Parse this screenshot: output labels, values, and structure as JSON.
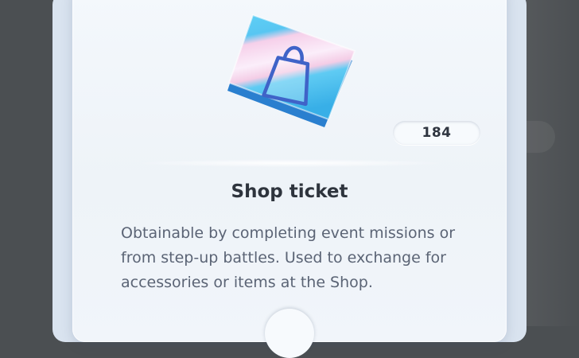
{
  "item": {
    "name": "Shop ticket",
    "count": "184",
    "description": "Obtainable by completing event missions or from step-up battles. Used to exchange for accessories or items at the Shop.",
    "icon": "shopping-bag-icon"
  },
  "colors": {
    "ticket_blue": "#3ab3ea",
    "ticket_pink": "#f3cbe6",
    "bag_outline": "#3f63c8",
    "title_text": "#2e343d",
    "body_text": "#5b6475"
  }
}
